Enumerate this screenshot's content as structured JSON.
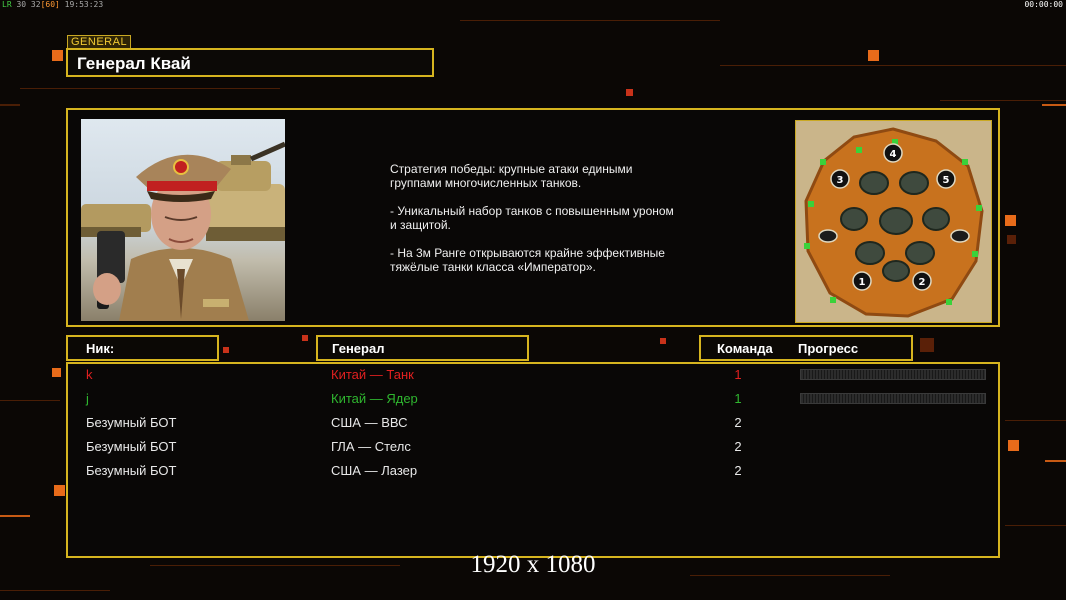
{
  "topbar": {
    "lr": "LR",
    "fps": "30 32",
    "limit": "[60]",
    "clock": "19:53:23",
    "timer": "00:00:00"
  },
  "general": {
    "tag": "GENERAL",
    "title": "Генерал Квай"
  },
  "strategy_text": "Стратегия победы: крупные атаки едиными\n группами многочисленных танков.\n\n- Уникальный набор танков с повышенным уроном\n и защитой.\n\n- На 3м Ранге открываются крайне эффективные\n тяжёлые танки класса «Император».",
  "minimap": {
    "start_positions": [
      "1",
      "2",
      "3",
      "4",
      "5"
    ]
  },
  "table": {
    "headers": {
      "nick": "Ник:",
      "general": "Генерал",
      "team": "Команда",
      "progress": "Прогресс"
    },
    "players": [
      {
        "name": "k",
        "general": "Китай — Танк",
        "team": "1",
        "color": "#e02020",
        "show_progress": true
      },
      {
        "name": "j",
        "general": "Китай — Ядер",
        "team": "1",
        "color": "#2fb62f",
        "show_progress": true
      },
      {
        "name": "Безумный БОТ",
        "general": "США — ВВС",
        "team": "2",
        "color": "#e8e8e8",
        "show_progress": false
      },
      {
        "name": "Безумный БОТ",
        "general": "ГЛА — Стелс",
        "team": "2",
        "color": "#e8e8e8",
        "show_progress": false
      },
      {
        "name": "Безумный БОТ",
        "general": "США — Лазер",
        "team": "2",
        "color": "#e8e8e8",
        "show_progress": false
      }
    ]
  },
  "resolution_label": "1920 x 1080",
  "colors": {
    "frame": "#d6b41f",
    "accent_orange": "#e86b1a",
    "team1_red": "#e02020",
    "team1_green": "#2fb62f"
  }
}
